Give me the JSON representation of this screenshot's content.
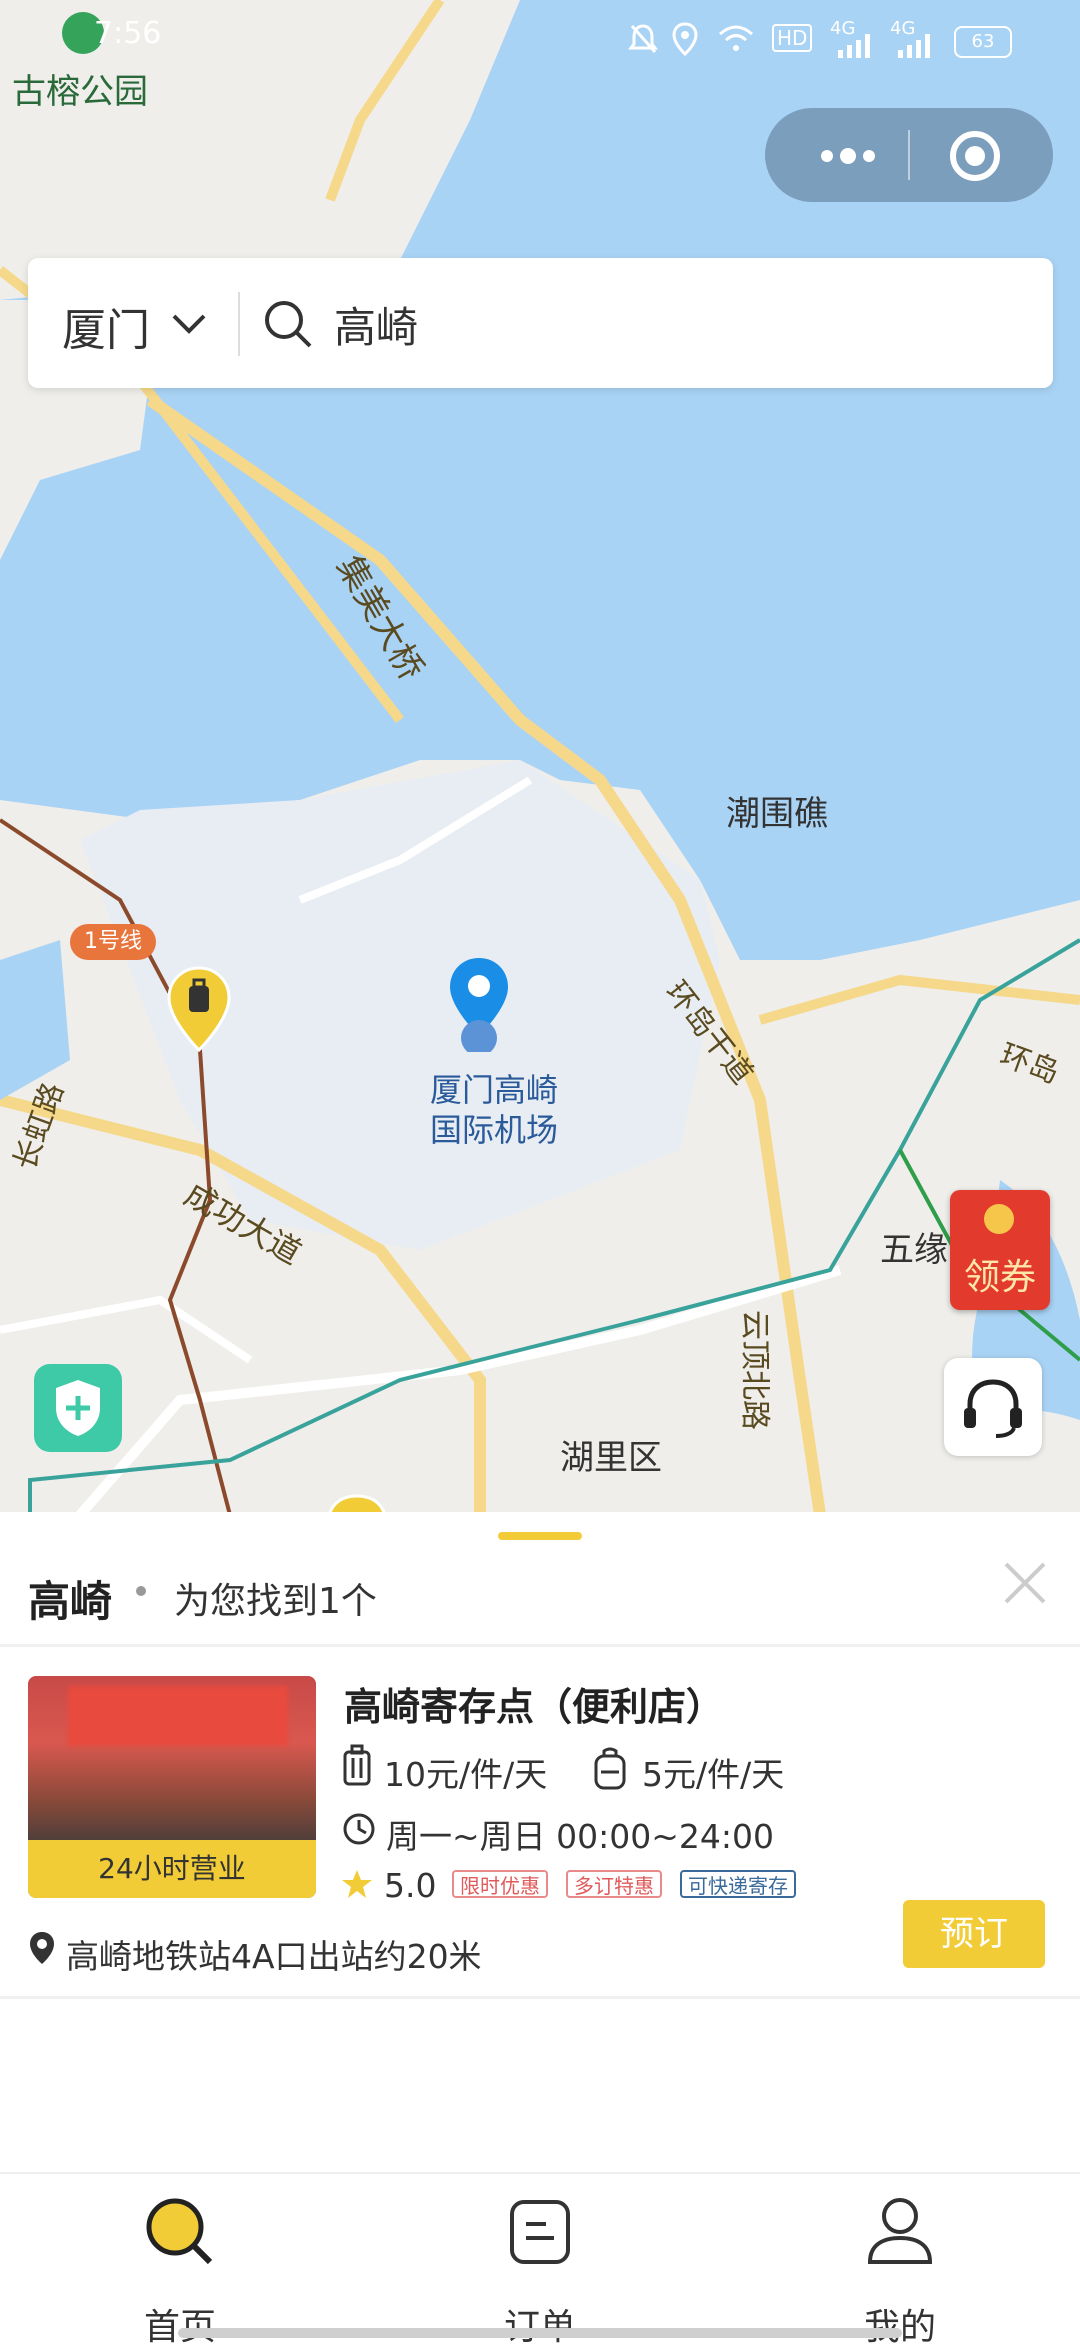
{
  "status_bar": {
    "time": "7:56",
    "battery": "63",
    "hd": "HD",
    "net": "4G"
  },
  "map": {
    "labels": {
      "park": "古榕公园",
      "bridge": "集美大桥",
      "reef": "潮围礁",
      "metro_line": "1号线",
      "airport_line1": "厦门高崎",
      "airport_line2": "国际机场",
      "ring_road": "环岛干道",
      "ring_road_right": "环岛",
      "avenue": "成功大道",
      "left_road": "长虹路",
      "wuyuan": "五缘",
      "district": "湖里区",
      "yunding": "云顶北路"
    },
    "coupon": "领券"
  },
  "search": {
    "city": "厦门",
    "query": "高崎"
  },
  "results": {
    "title": "高崎",
    "count_text": "为您找到1个",
    "store": {
      "badge": "24小时营业",
      "name": "高崎寄存点（便利店）",
      "price_luggage": "10元/件/天",
      "price_bag": "5元/件/天",
      "hours": "周一~周日 00:00~24:00",
      "rating": "5.0",
      "tags": [
        "限时优惠",
        "多订特惠",
        "可快递寄存"
      ],
      "address": "高崎地铁站4A口出站约20米",
      "book": "预订"
    }
  },
  "tabbar": {
    "home": "首页",
    "orders": "订单",
    "mine": "我的"
  },
  "colors": {
    "accent": "#f2cc36",
    "water": "#a9d3f5",
    "land": "#f1f1ef",
    "road": "#f6d88a"
  }
}
